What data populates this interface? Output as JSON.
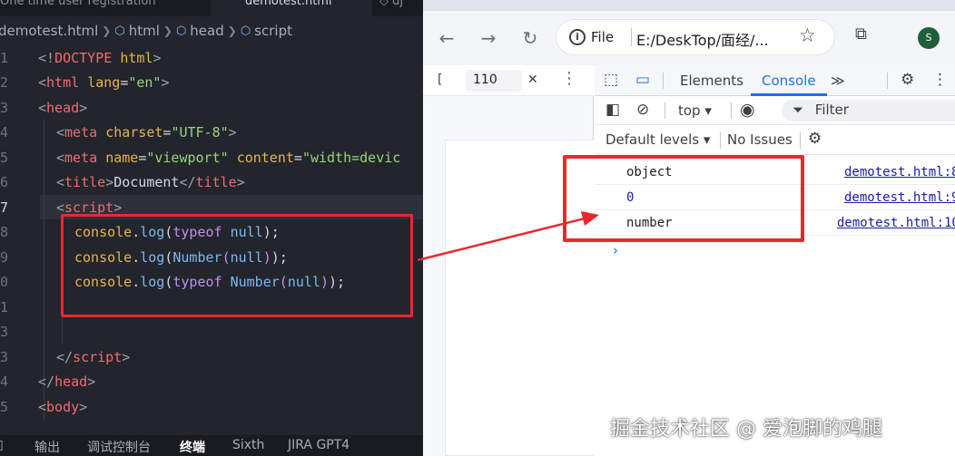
{
  "editor": {
    "tabs": [
      "One time user registration",
      "demotest.html"
    ],
    "breadcrumb": [
      "demotest.html",
      "html",
      "head",
      "script"
    ],
    "lines": [
      {
        "no": "1"
      },
      {
        "no": "2"
      },
      {
        "no": "3"
      },
      {
        "no": "4"
      },
      {
        "no": "5"
      },
      {
        "no": "6"
      },
      {
        "no": "7"
      },
      {
        "no": "8"
      },
      {
        "no": "9"
      },
      {
        "no": "0"
      },
      {
        "no": "1"
      },
      {
        "no": "3"
      },
      {
        "no": "4"
      },
      {
        "no": "5"
      }
    ],
    "bottom_tabs": [
      "输出",
      "调试控制台",
      "终端",
      "Sixth",
      "JIRA GPT4"
    ]
  },
  "browser": {
    "file_label": "File",
    "url": "E:/DeskTop/面经/...",
    "avatar_initial": "S",
    "viewport_width": "110",
    "devtools": {
      "tabs": [
        "Elements",
        "Console"
      ],
      "context": "top",
      "filter_placeholder": "Filter",
      "levels": "Default levels",
      "issues": "No Issues",
      "console_rows": [
        {
          "message": "object",
          "source": "demotest.html:8"
        },
        {
          "message": "0",
          "source": "demotest.html:9"
        },
        {
          "message": "number",
          "source": "demotest.html:10"
        }
      ]
    }
  },
  "watermark": "掘金技术社区 @ 爱泡脚的鸡腿",
  "colors": {
    "highlight_red": "#e8282f",
    "console_tab_blue": "#1a73e8"
  }
}
